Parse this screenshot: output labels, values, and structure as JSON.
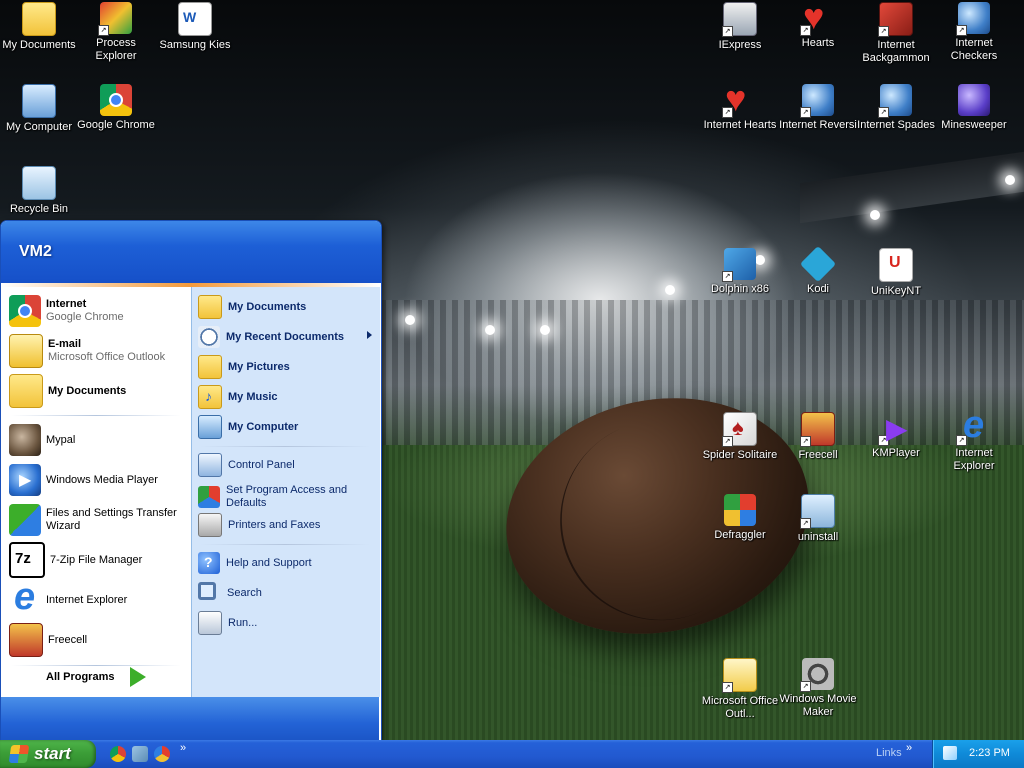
{
  "desktop": {
    "icons": [
      {
        "label": "My Documents",
        "icon": "folder-documents-icon"
      },
      {
        "label": "Process Explorer",
        "icon": "process-explorer-icon"
      },
      {
        "label": "Samsung Kies",
        "icon": "document-icon"
      },
      {
        "label": "My Computer",
        "icon": "computer-icon"
      },
      {
        "label": "Google Chrome",
        "icon": "chrome-icon"
      },
      {
        "label": "Recycle Bin",
        "icon": "recycle-bin-icon"
      },
      {
        "label": "IExpress",
        "icon": "iexpress-icon"
      },
      {
        "label": "Hearts",
        "icon": "hearts-icon"
      },
      {
        "label": "Internet Backgammon",
        "icon": "backgammon-icon"
      },
      {
        "label": "Internet Checkers",
        "icon": "checkers-icon"
      },
      {
        "label": "Internet Hearts",
        "icon": "internet-hearts-icon"
      },
      {
        "label": "Internet Reversi",
        "icon": "reversi-icon"
      },
      {
        "label": "Internet Spades",
        "icon": "spades-icon"
      },
      {
        "label": "Minesweeper",
        "icon": "minesweeper-icon"
      },
      {
        "label": "Dolphin x86",
        "icon": "dolphin-icon"
      },
      {
        "label": "Kodi",
        "icon": "kodi-icon"
      },
      {
        "label": "UniKeyNT",
        "icon": "unikey-icon"
      },
      {
        "label": "Spider Solitaire",
        "icon": "spider-solitaire-icon"
      },
      {
        "label": "Freecell",
        "icon": "freecell-icon"
      },
      {
        "label": "KMPlayer",
        "icon": "kmplayer-icon"
      },
      {
        "label": "Internet Explorer",
        "icon": "internet-explorer-icon"
      },
      {
        "label": "Defraggler",
        "icon": "defraggler-icon"
      },
      {
        "label": "uninstall",
        "icon": "uninstall-icon"
      },
      {
        "label": "Microsoft Office Outl...",
        "icon": "outlook-icon"
      },
      {
        "label": "Windows Movie Maker",
        "icon": "movie-maker-icon"
      }
    ]
  },
  "start_menu": {
    "user": "VM2",
    "pinned": [
      {
        "title": "Internet",
        "subtitle": "Google Chrome",
        "icon": "chrome-icon"
      },
      {
        "title": "E-mail",
        "subtitle": "Microsoft Office Outlook",
        "icon": "email-icon"
      },
      {
        "title": "My Documents",
        "icon": "folder-documents-icon"
      }
    ],
    "recent": [
      {
        "label": "Mypal",
        "icon": "mypal-icon"
      },
      {
        "label": "Windows Media Player",
        "icon": "media-player-icon"
      },
      {
        "label": "Files and Settings Transfer Wizard",
        "icon": "transfer-wizard-icon"
      },
      {
        "label": "7-Zip File Manager",
        "icon": "seven-zip-icon"
      },
      {
        "label": "Internet Explorer",
        "icon": "internet-explorer-icon"
      },
      {
        "label": "Freecell",
        "icon": "freecell-icon"
      }
    ],
    "all_programs": "All Programs",
    "right": [
      {
        "label": "My Documents",
        "icon": "folder-documents-icon"
      },
      {
        "label": "My Recent Documents",
        "icon": "recent-documents-icon"
      },
      {
        "label": "My Pictures",
        "icon": "folder-pictures-icon"
      },
      {
        "label": "My Music",
        "icon": "folder-music-icon"
      },
      {
        "label": "My Computer",
        "icon": "computer-icon"
      },
      {
        "label": "Control Panel",
        "icon": "control-panel-icon"
      },
      {
        "label": "Set Program Access and Defaults",
        "icon": "program-access-icon"
      },
      {
        "label": "Printers and Faxes",
        "icon": "printer-icon"
      },
      {
        "label": "Help and Support",
        "icon": "help-icon"
      },
      {
        "label": "Search",
        "icon": "search-icon"
      },
      {
        "label": "Run...",
        "icon": "run-icon"
      }
    ]
  },
  "taskbar": {
    "start_label": "start",
    "quick_more": "»",
    "links_label": "Links",
    "links_more": "»",
    "clock": "2:23 PM"
  }
}
